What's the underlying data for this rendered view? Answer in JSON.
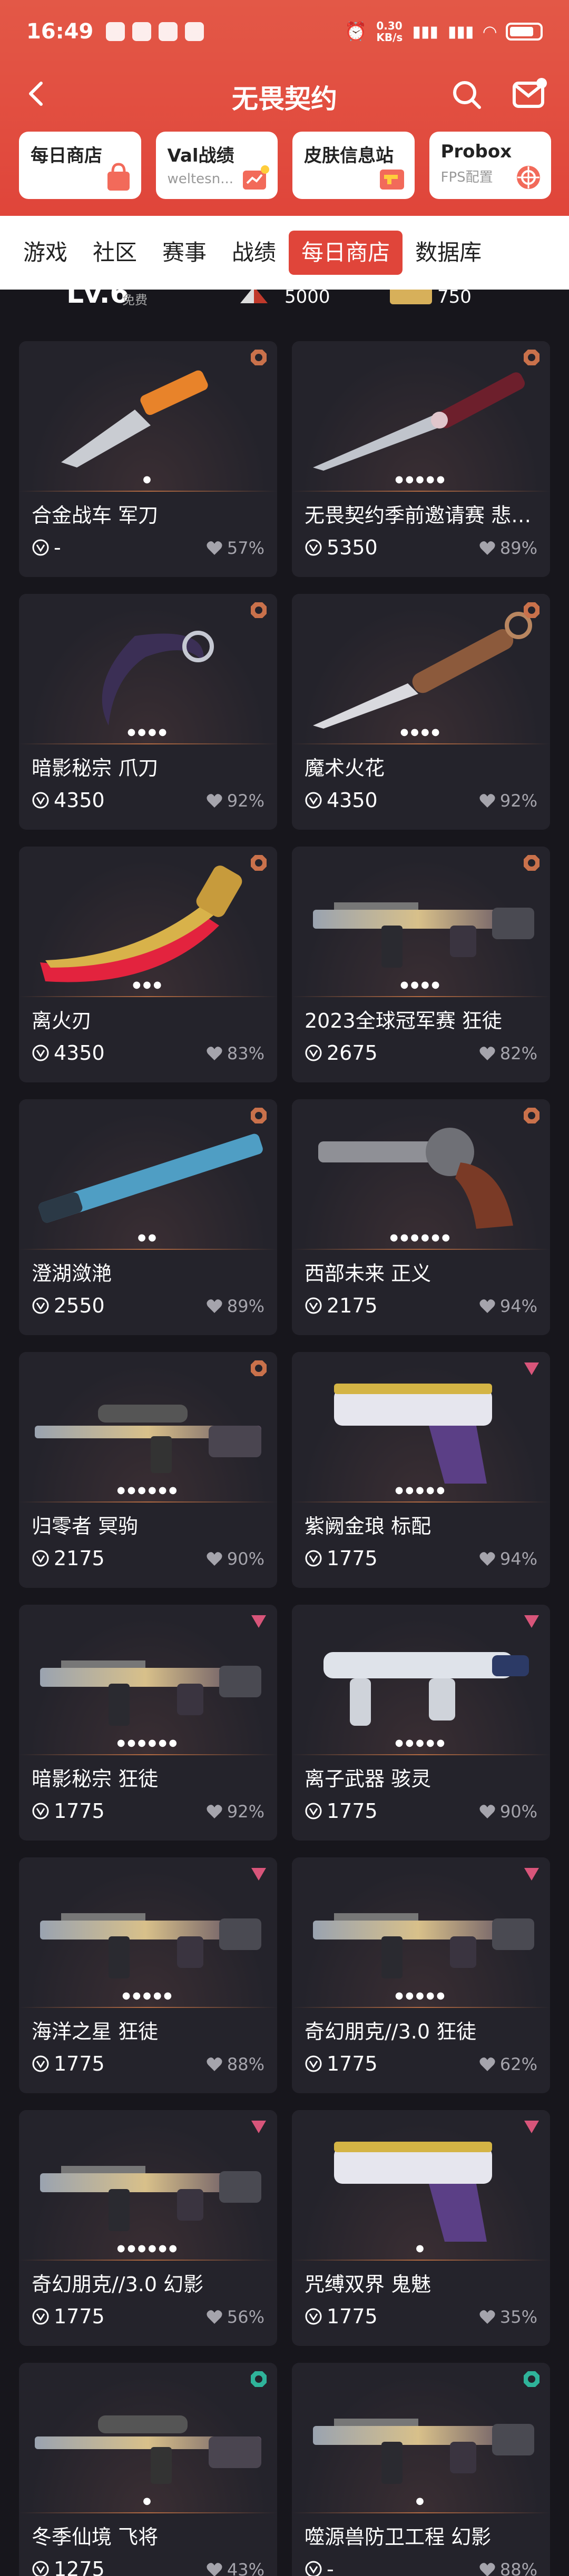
{
  "status_bar": {
    "time": "16:49",
    "net_speed_value": "0.30",
    "net_speed_unit": "KB/s",
    "battery": "battery"
  },
  "header": {
    "title": "无畏契约"
  },
  "quick_links": [
    {
      "title": "每日商店",
      "subtitle": "",
      "icon": "shop-bag-icon"
    },
    {
      "title": "Val战绩",
      "subtitle": "weltesn...",
      "icon": "chart-bag-icon"
    },
    {
      "title": "皮肤信息站",
      "subtitle": "",
      "icon": "gun-box-icon"
    },
    {
      "title": "Probox",
      "subtitle": "FPS配置",
      "icon": "crosshair-icon"
    }
  ],
  "tabs": [
    {
      "label": "游戏",
      "active": false
    },
    {
      "label": "社区",
      "active": false
    },
    {
      "label": "赛事",
      "active": false
    },
    {
      "label": "战绩",
      "active": false
    },
    {
      "label": "每日商店",
      "active": true
    },
    {
      "label": "数据库",
      "active": false
    }
  ],
  "profile_strip": {
    "level": "Lv.6",
    "free_label": "免费",
    "radiant_points": "5000",
    "gold_points": "750"
  },
  "colors": {
    "accent": "#e0453a",
    "card_bg": "#24232b",
    "page_bg": "#17161c",
    "tier_orange": "#c9714b",
    "tier_pink": "#d8557a",
    "tier_teal": "#2fb39a"
  },
  "items": [
    {
      "name": "合金战车 军刀",
      "price": "-",
      "like": "57%",
      "tier": "orange",
      "dots": "●",
      "weapon": "knife"
    },
    {
      "name": "无畏契约季前邀请赛 悲…",
      "price": "5350",
      "like": "89%",
      "tier": "orange",
      "dots": "●●●●●",
      "weapon": "dagger"
    },
    {
      "name": "暗影秘宗 爪刀",
      "price": "4350",
      "like": "92%",
      "tier": "orange",
      "dots": "●●●●",
      "weapon": "karambit"
    },
    {
      "name": "魔术火花",
      "price": "4350",
      "like": "92%",
      "tier": "orange",
      "dots": "●●●●",
      "weapon": "kunai"
    },
    {
      "name": "离火刃",
      "price": "4350",
      "like": "83%",
      "tier": "orange",
      "dots": "●●●",
      "weapon": "blade"
    },
    {
      "name": "2023全球冠军赛 狂徒",
      "price": "2675",
      "like": "82%",
      "tier": "orange",
      "dots": "●●●●",
      "weapon": "rifle"
    },
    {
      "name": "澄湖潋滟",
      "price": "2550",
      "like": "89%",
      "tier": "orange",
      "dots": "●●",
      "weapon": "staff"
    },
    {
      "name": "西部未来 正义",
      "price": "2175",
      "like": "94%",
      "tier": "orange",
      "dots": "●●●●●●",
      "weapon": "revolver"
    },
    {
      "name": "归零者 冥驹",
      "price": "2175",
      "like": "90%",
      "tier": "orange",
      "dots": "●●●●●●",
      "weapon": "sniper"
    },
    {
      "name": "紫阙金琅 标配",
      "price": "1775",
      "like": "94%",
      "tier": "pink",
      "dots": "●●●●●",
      "weapon": "pistol"
    },
    {
      "name": "暗影秘宗 狂徒",
      "price": "1775",
      "like": "92%",
      "tier": "pink",
      "dots": "●●●●●●",
      "weapon": "rifle"
    },
    {
      "name": "离子武器 骇灵",
      "price": "1775",
      "like": "90%",
      "tier": "pink",
      "dots": "●●●●●",
      "weapon": "smg"
    },
    {
      "name": "海洋之星 狂徒",
      "price": "1775",
      "like": "88%",
      "tier": "pink",
      "dots": "●●●●●",
      "weapon": "rifle"
    },
    {
      "name": "奇幻朋克//3.0 狂徒",
      "price": "1775",
      "like": "62%",
      "tier": "pink",
      "dots": "●●●●●",
      "weapon": "rifle"
    },
    {
      "name": "奇幻朋克//3.0 幻影",
      "price": "1775",
      "like": "56%",
      "tier": "pink",
      "dots": "●●●●●●",
      "weapon": "rifle"
    },
    {
      "name": "咒缚双界 鬼魅",
      "price": "1775",
      "like": "35%",
      "tier": "pink",
      "dots": "●",
      "weapon": "pistol"
    },
    {
      "name": "冬季仙境 飞将",
      "price": "1275",
      "like": "43%",
      "tier": "teal",
      "dots": "●",
      "weapon": "sniper"
    },
    {
      "name": "噬源兽防卫工程 幻影",
      "price": "-",
      "like": "88%",
      "tier": "teal",
      "dots": "●",
      "weapon": "rifle"
    }
  ]
}
